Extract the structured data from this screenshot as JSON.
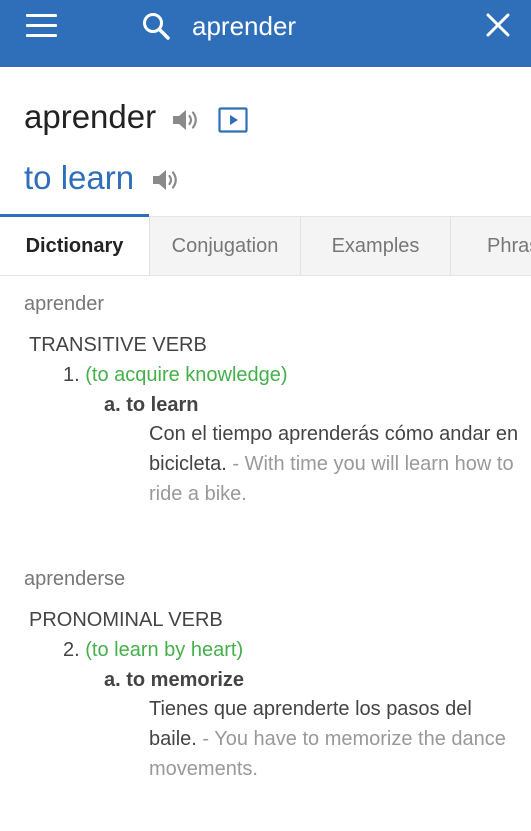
{
  "search": {
    "query": "aprender"
  },
  "header": {
    "headword": "aprender",
    "translation": "to learn"
  },
  "tabs": [
    {
      "label": "Dictionary"
    },
    {
      "label": "Conjugation"
    },
    {
      "label": "Examples"
    },
    {
      "label": "Phrases"
    }
  ],
  "entries": [
    {
      "word": "aprender",
      "pos": "TRANSITIVE VERB",
      "sense_number": "1.",
      "gloss": "(to acquire knowledge)",
      "translation": "a. to learn",
      "example_es": "Con el tiempo aprenderás cómo andar en bicicleta.",
      "example_en": " - With time you will learn how to ride a bike."
    },
    {
      "word": "aprenderse",
      "pos": "PRONOMINAL VERB",
      "sense_number": "2.",
      "gloss": "(to learn by heart)",
      "translation": "a. to memorize",
      "example_es": "Tienes que aprenderte los pasos del baile. ",
      "example_en": " - You have to memorize the dance movements."
    }
  ],
  "colors": {
    "brand": "#2f6fb9",
    "gloss": "#44b04a"
  },
  "icons": [
    "menu-icon",
    "search-icon",
    "close-icon",
    "speaker-icon",
    "video-icon"
  ]
}
